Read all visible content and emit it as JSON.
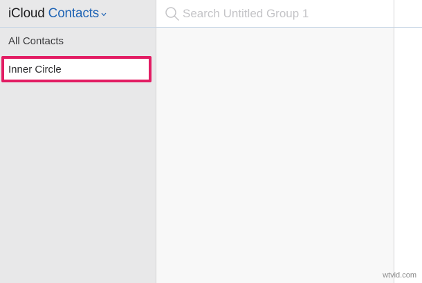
{
  "header": {
    "brand": "iCloud",
    "app_name": "Contacts"
  },
  "sidebar": {
    "items": [
      {
        "label": "All Contacts"
      }
    ],
    "editing_group": {
      "value": "Inner Circle"
    }
  },
  "search": {
    "placeholder": "Search Untitled Group 1"
  },
  "watermark": "wtvid.com",
  "colors": {
    "accent": "#1f64b5",
    "highlight_border": "#e21c63",
    "sidebar_bg": "#e8e8e9"
  },
  "icons": {
    "app_switch": "chevron-down-icon",
    "search": "search-icon"
  }
}
